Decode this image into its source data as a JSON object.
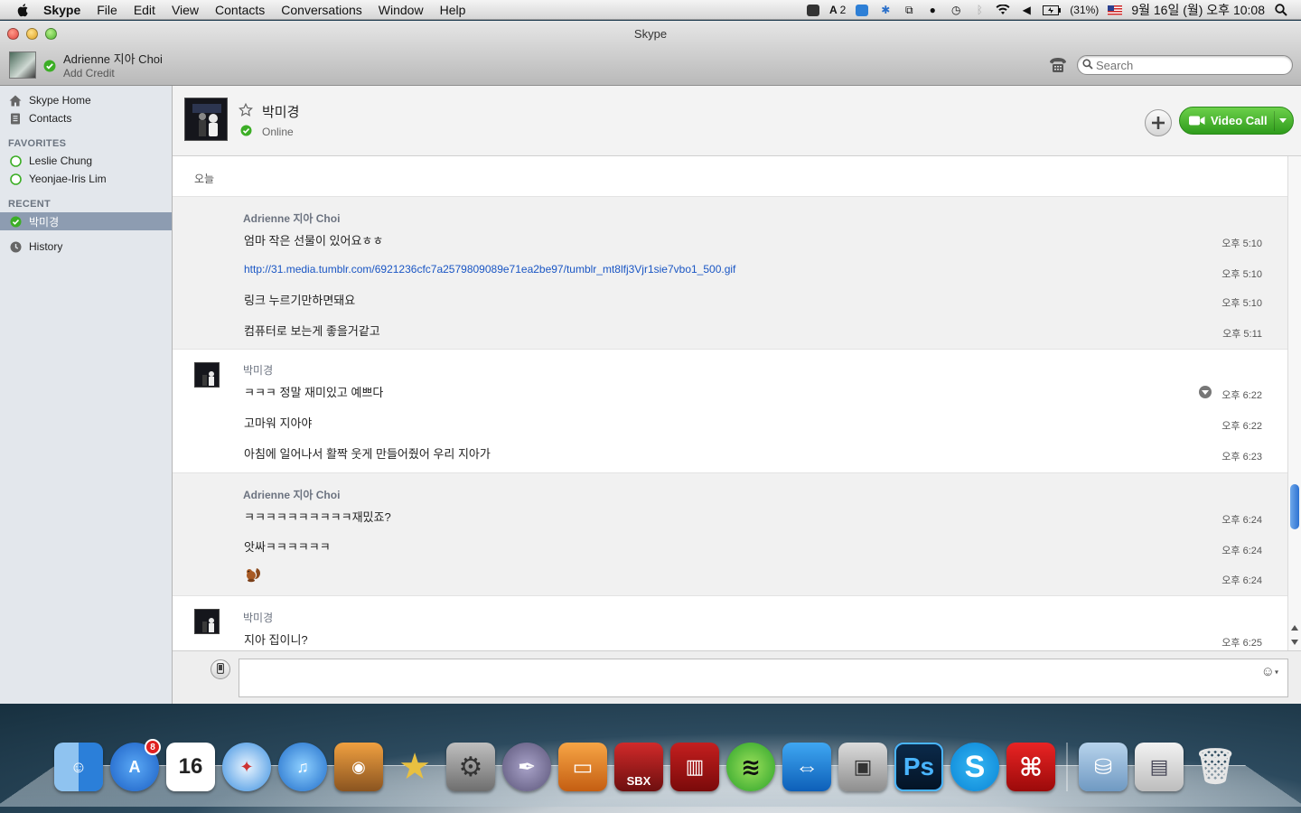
{
  "menubar": {
    "app_name": "Skype",
    "items": [
      "File",
      "Edit",
      "View",
      "Contacts",
      "Conversations",
      "Window",
      "Help"
    ],
    "status": {
      "input_mode": "2",
      "battery": "(31%)",
      "datetime": "9월 16일 (월) 오후 10:08"
    }
  },
  "window": {
    "title": "Skype",
    "profile": {
      "name": "Adrienne 지아 Choi",
      "credit": "Add Credit"
    },
    "search": {
      "placeholder": "Search"
    }
  },
  "sidebar": {
    "nav": [
      "Skype Home",
      "Contacts"
    ],
    "favorites_heading": "FAVORITES",
    "favorites": [
      "Leslie Chung",
      "Yeonjae-Iris Lim"
    ],
    "recent_heading": "RECENT",
    "recent": [
      "박미경"
    ],
    "history": "History"
  },
  "conversation": {
    "contact_name": "박미경",
    "contact_status": "Online",
    "video_call_label": "Video Call",
    "day_label": "오늘",
    "groups": [
      {
        "sender": "Adrienne 지아 Choi",
        "messages": [
          {
            "text": "엄마 작은 선물이 있어요ㅎㅎ",
            "time": "오후 5:10"
          },
          {
            "text": "http://31.media.tumblr.com/6921236cfc7a2579809089e71ea2be97/tumblr_mt8lfj3Vjr1sie7vbo1_500.gif",
            "time": "오후 5:10"
          },
          {
            "text": "링크 누르기만하면돼요",
            "time": "오후 5:10"
          },
          {
            "text": "컴퓨터로 보는게 좋을거같고",
            "time": "오후 5:11"
          }
        ]
      },
      {
        "sender": "박미경",
        "messages": [
          {
            "text": "ㅋㅋㅋ 정말 재미있고 예쁘다",
            "time": "오후 6:22"
          },
          {
            "text": "고마워 지아야",
            "time": "오후 6:22"
          },
          {
            "text": "아침에  일어나서 활짝 웃게 만들어줬어 우리 지아가",
            "time": "오후 6:23"
          }
        ]
      },
      {
        "sender": "Adrienne 지아 Choi",
        "messages": [
          {
            "text": "ㅋㅋㅋㅋㅋㅋㅋㅋㅋㅋ재밌죠?",
            "time": "오후 6:24"
          },
          {
            "text": "앗싸ㅋㅋㅋㅋㅋㅋ",
            "time": "오후 6:24"
          },
          {
            "text": "",
            "time": "오후 6:24"
          }
        ]
      },
      {
        "sender": "박미경",
        "messages": [
          {
            "text": "지아 집이니?",
            "time": "오후 6:25"
          }
        ]
      }
    ]
  },
  "input": {
    "value": ""
  },
  "dock": {
    "app_store_badge": "8",
    "calendar_day": "16",
    "photoshop_label": "Ps",
    "sbx_label": "SBX"
  },
  "colors": {
    "accent_green": "#3cae26",
    "link_blue": "#1a56c4",
    "selected_row": "#8d9cb1",
    "sidebar_bg": "#e3e7ec"
  }
}
